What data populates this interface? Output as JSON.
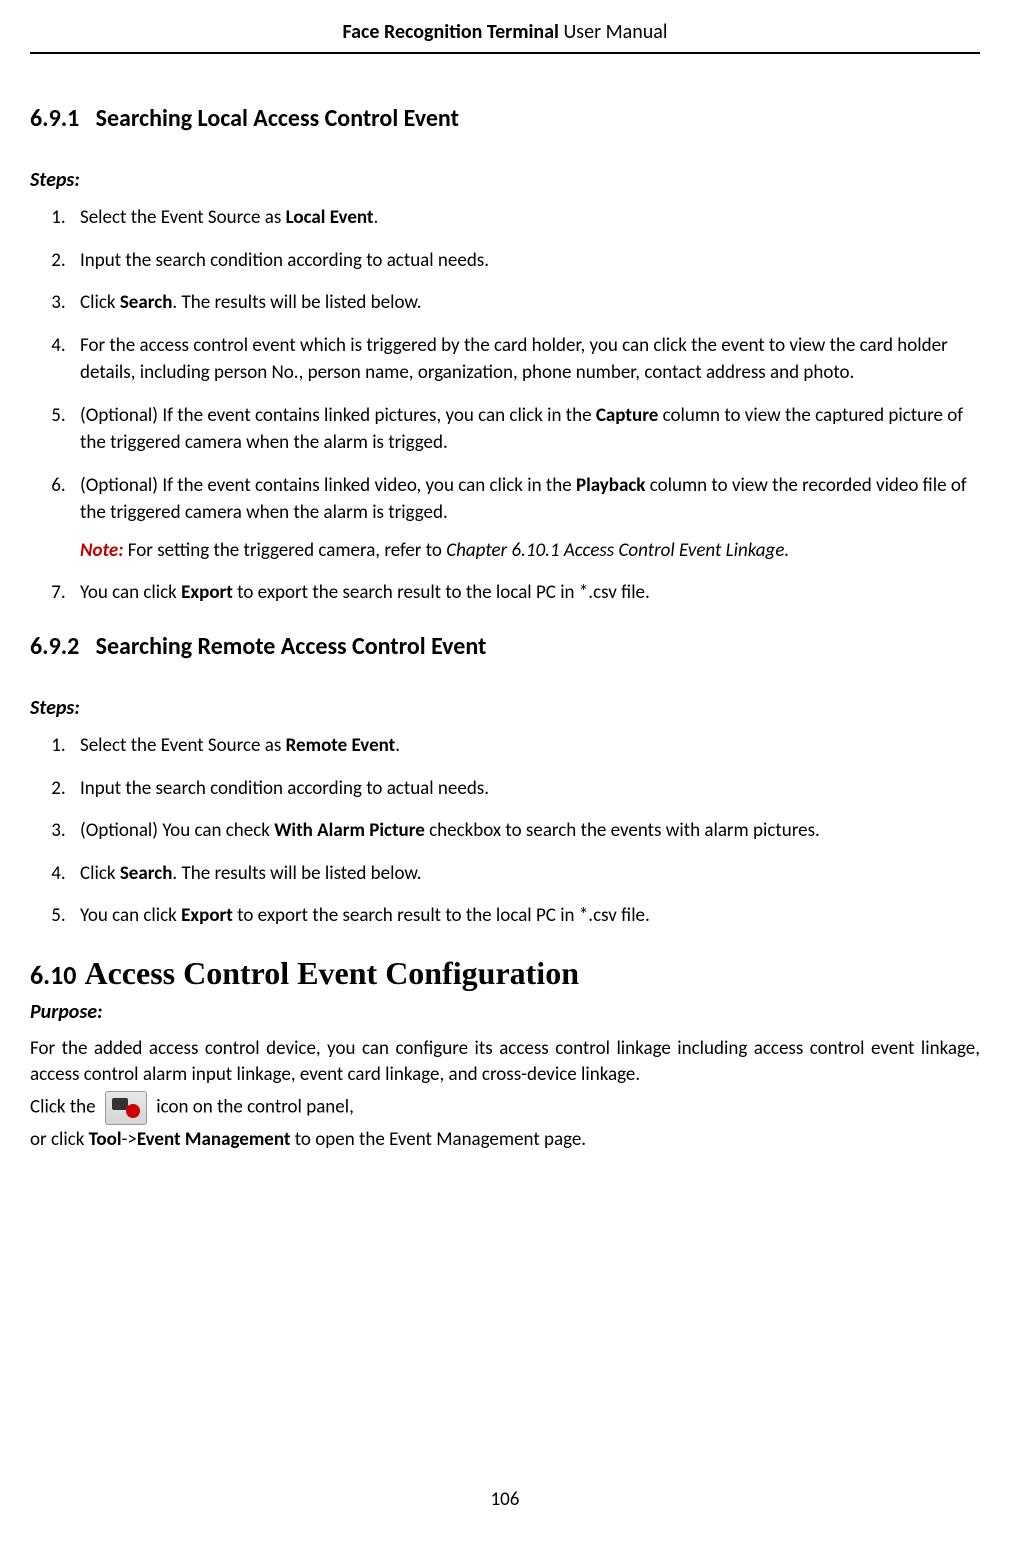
{
  "header": {
    "bold_part": "Face Recognition Terminal",
    "normal_part": "  User Manual"
  },
  "section_691": {
    "heading_num": "6.9.1",
    "heading_text": "Searching Local Access Control Event",
    "steps_label": "Steps:",
    "steps": {
      "s1_pre": "Select the Event Source as ",
      "s1_bold": "Local Event",
      "s1_post": ".",
      "s2": "Input the search condition according to actual needs.",
      "s3_pre": "Click ",
      "s3_bold": "Search",
      "s3_post": ". The results will be listed below.",
      "s4": "For the access control event which is triggered by the card holder, you can click the event to view the card holder details, including person No., person name, organization, phone number, contact address and photo.",
      "s5_pre": "(Optional) If the event contains linked pictures, you can click in the ",
      "s5_bold": "Capture",
      "s5_post": " column to view the captured picture of the triggered camera when the alarm is trigged.",
      "s6_pre": "(Optional) If the event contains linked video, you can click in the ",
      "s6_bold": "Playback",
      "s6_post": " column to view the recorded video file of the triggered camera when the alarm is trigged.",
      "s6_note_label": "Note:",
      "s6_note_text": " For setting the triggered camera, refer to ",
      "s6_note_italic": "Chapter 6.10.1 Access Control Event Linkage.",
      "s7_pre": "You can click ",
      "s7_bold": "Export",
      "s7_post": " to export the search result to the local PC in *.csv file."
    }
  },
  "section_692": {
    "heading_num": "6.9.2",
    "heading_text": "Searching Remote Access Control Event",
    "steps_label": "Steps:",
    "steps": {
      "s1_pre": "Select the Event Source as ",
      "s1_bold": "Remote Event",
      "s1_post": ".",
      "s2": "Input the search condition according to actual needs.",
      "s3_pre": "(Optional) You can check ",
      "s3_bold": "With Alarm Picture",
      "s3_post": " checkbox to search the events with alarm pictures.",
      "s4_pre": "Click ",
      "s4_bold": "Search",
      "s4_post": ". The results will be listed below.",
      "s5_pre": "You can click ",
      "s5_bold": "Export",
      "s5_post": " to export the search result to the local PC in *.csv file."
    }
  },
  "section_610": {
    "heading_num": "6.10",
    "heading_text": "Access Control Event Configuration",
    "purpose_label": "Purpose:",
    "purpose_body": "For the added access control device, you can configure its access control linkage including access control event linkage, access control alarm input linkage, event card linkage, and cross-device linkage.",
    "click_pre": "Click the ",
    "click_post": " icon on the control panel,",
    "or_click_pre": "or click ",
    "or_click_bold1": "Tool",
    "or_click_arrow": "->",
    "or_click_bold2": "Event Management",
    "or_click_post": " to open the Event Management page."
  },
  "page_number": "106"
}
